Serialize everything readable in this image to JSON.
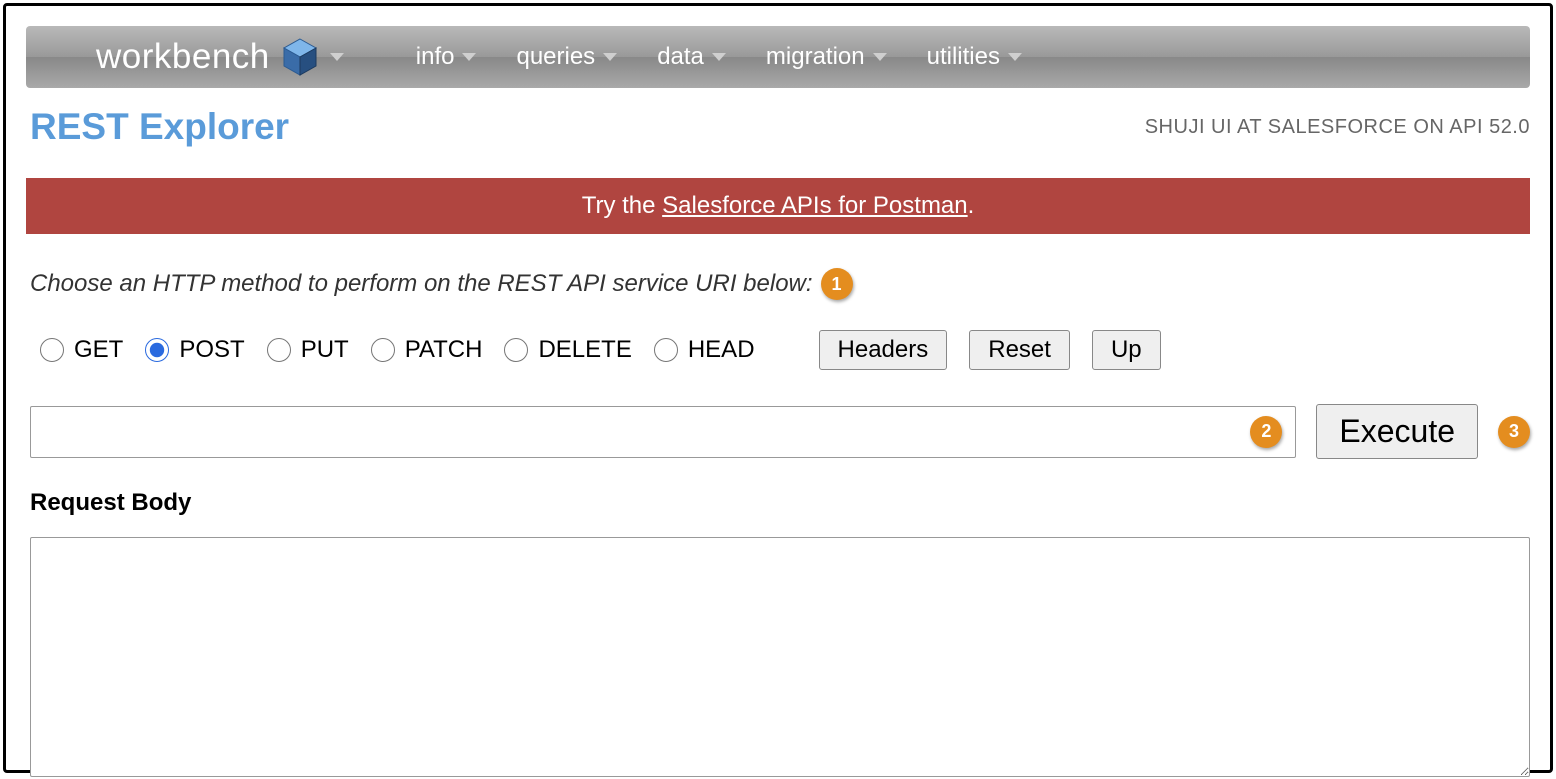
{
  "brand": "workbench",
  "nav": [
    "info",
    "queries",
    "data",
    "migration",
    "utilities"
  ],
  "page_title": "REST Explorer",
  "org_status": "SHUJI UI AT SALESFORCE ON API 52.0",
  "banner": {
    "prefix": "Try the ",
    "link_text": "Salesforce APIs for Postman",
    "suffix": "."
  },
  "instruction": "Choose an HTTP method to perform on the REST API service URI below:",
  "callouts": {
    "method": "1",
    "uri": "2",
    "execute": "3"
  },
  "methods": [
    {
      "label": "GET",
      "checked": false
    },
    {
      "label": "POST",
      "checked": true
    },
    {
      "label": "PUT",
      "checked": false
    },
    {
      "label": "PATCH",
      "checked": false
    },
    {
      "label": "DELETE",
      "checked": false
    },
    {
      "label": "HEAD",
      "checked": false
    }
  ],
  "buttons": {
    "headers": "Headers",
    "reset": "Reset",
    "up": "Up",
    "execute": "Execute"
  },
  "uri_value": "",
  "body_label": "Request Body",
  "body_value": ""
}
